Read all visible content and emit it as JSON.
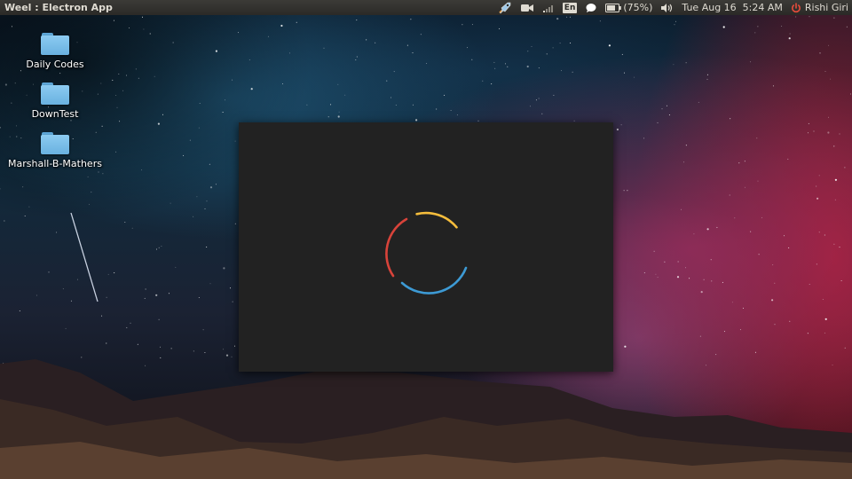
{
  "top_panel": {
    "app_title": "Weel : Electron App",
    "indicators": {
      "launcher_icon": "rocket-icon",
      "video_icon": "camera-icon",
      "network_icon": "signal-icon",
      "language": "En",
      "messaging_icon": "chat-bubble-icon",
      "battery_icon": "battery-icon",
      "battery_percent": "(75%)",
      "volume_icon": "speaker-icon",
      "datetime": "Tue Aug 16  5:24 AM",
      "session_icon": "power-icon",
      "user_name": "Rishi Giri"
    }
  },
  "desktop": {
    "icons": [
      {
        "label": "Daily Codes",
        "icon": "folder-icon"
      },
      {
        "label": "DownTest",
        "icon": "folder-icon"
      },
      {
        "label": "Marshall-B-Mathers",
        "icon": "folder-icon"
      }
    ]
  },
  "app_window": {
    "background": "#222222",
    "spinner": {
      "icon": "loading-spinner-icon",
      "colors": {
        "yellow": "#f5bd3c",
        "blue": "#3d9ad4",
        "red": "#d8433a"
      }
    }
  },
  "colors": {
    "panel": "#3c3b37",
    "panel_text": "#dfdbd2",
    "power_icon": "#e74c3c",
    "folder": "#7cc0ec"
  }
}
